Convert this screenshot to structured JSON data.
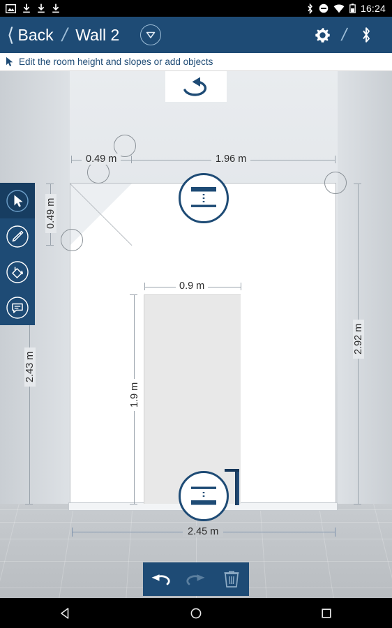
{
  "statusbar": {
    "time": "16:24",
    "left_icons": [
      "image-icon",
      "download-icon",
      "download-icon",
      "download-icon"
    ],
    "right_icons": [
      "bluetooth-icon",
      "do-not-disturb-icon",
      "wifi-icon",
      "battery-icon"
    ]
  },
  "appbar": {
    "back_label": "Back",
    "separator": "/",
    "title": "Wall 2",
    "dropdown_icon": "chevron-down-circle-icon",
    "settings_icon": "gear-icon",
    "bluetooth_icon": "bluetooth-icon"
  },
  "hintbar": {
    "cursor_icon": "cursor-arrow-icon",
    "text": "Edit the room height and slopes or add objects"
  },
  "canvas": {
    "rotate_button": {
      "icon": "rotate-left-icon",
      "label": ""
    },
    "dimensions": {
      "top_left": "0.49 m",
      "top_right": "1.96 m",
      "left_upper": "0.49 m",
      "left_lower": "2.43 m",
      "right": "2.92 m",
      "door_width": "0.9 m",
      "door_height": "1.9 m",
      "bottom": "2.45 m"
    },
    "handles": {
      "top_resize": "height-resize-handle",
      "bottom_resize": "height-resize-handle",
      "slope_points": [
        "slope-handle",
        "slope-handle",
        "slope-handle"
      ]
    }
  },
  "toolrail": {
    "items": [
      {
        "name": "select-tool",
        "icon": "cursor-arrow-icon",
        "active": true
      },
      {
        "name": "draw-tool",
        "icon": "pencil-icon",
        "active": false
      },
      {
        "name": "fill-tool",
        "icon": "paint-bucket-icon",
        "active": false
      },
      {
        "name": "note-tool",
        "icon": "comment-icon",
        "active": false
      }
    ]
  },
  "actionbar": {
    "items": [
      {
        "name": "undo-button",
        "icon": "undo-arrow-icon",
        "enabled": true
      },
      {
        "name": "redo-button",
        "icon": "redo-arrow-icon",
        "enabled": false
      },
      {
        "name": "delete-button",
        "icon": "trash-icon",
        "enabled": true
      }
    ]
  },
  "navbar": {
    "back_icon": "triangle-back-icon",
    "home_icon": "circle-home-icon",
    "recents_icon": "square-recents-icon"
  },
  "colors": {
    "accent": "#1e4b75",
    "accent_dark": "#173d61",
    "status_bg": "#000000",
    "canvas_top": "#e9ecef",
    "wall": "#ffffff",
    "door": "#e8e8e8"
  }
}
